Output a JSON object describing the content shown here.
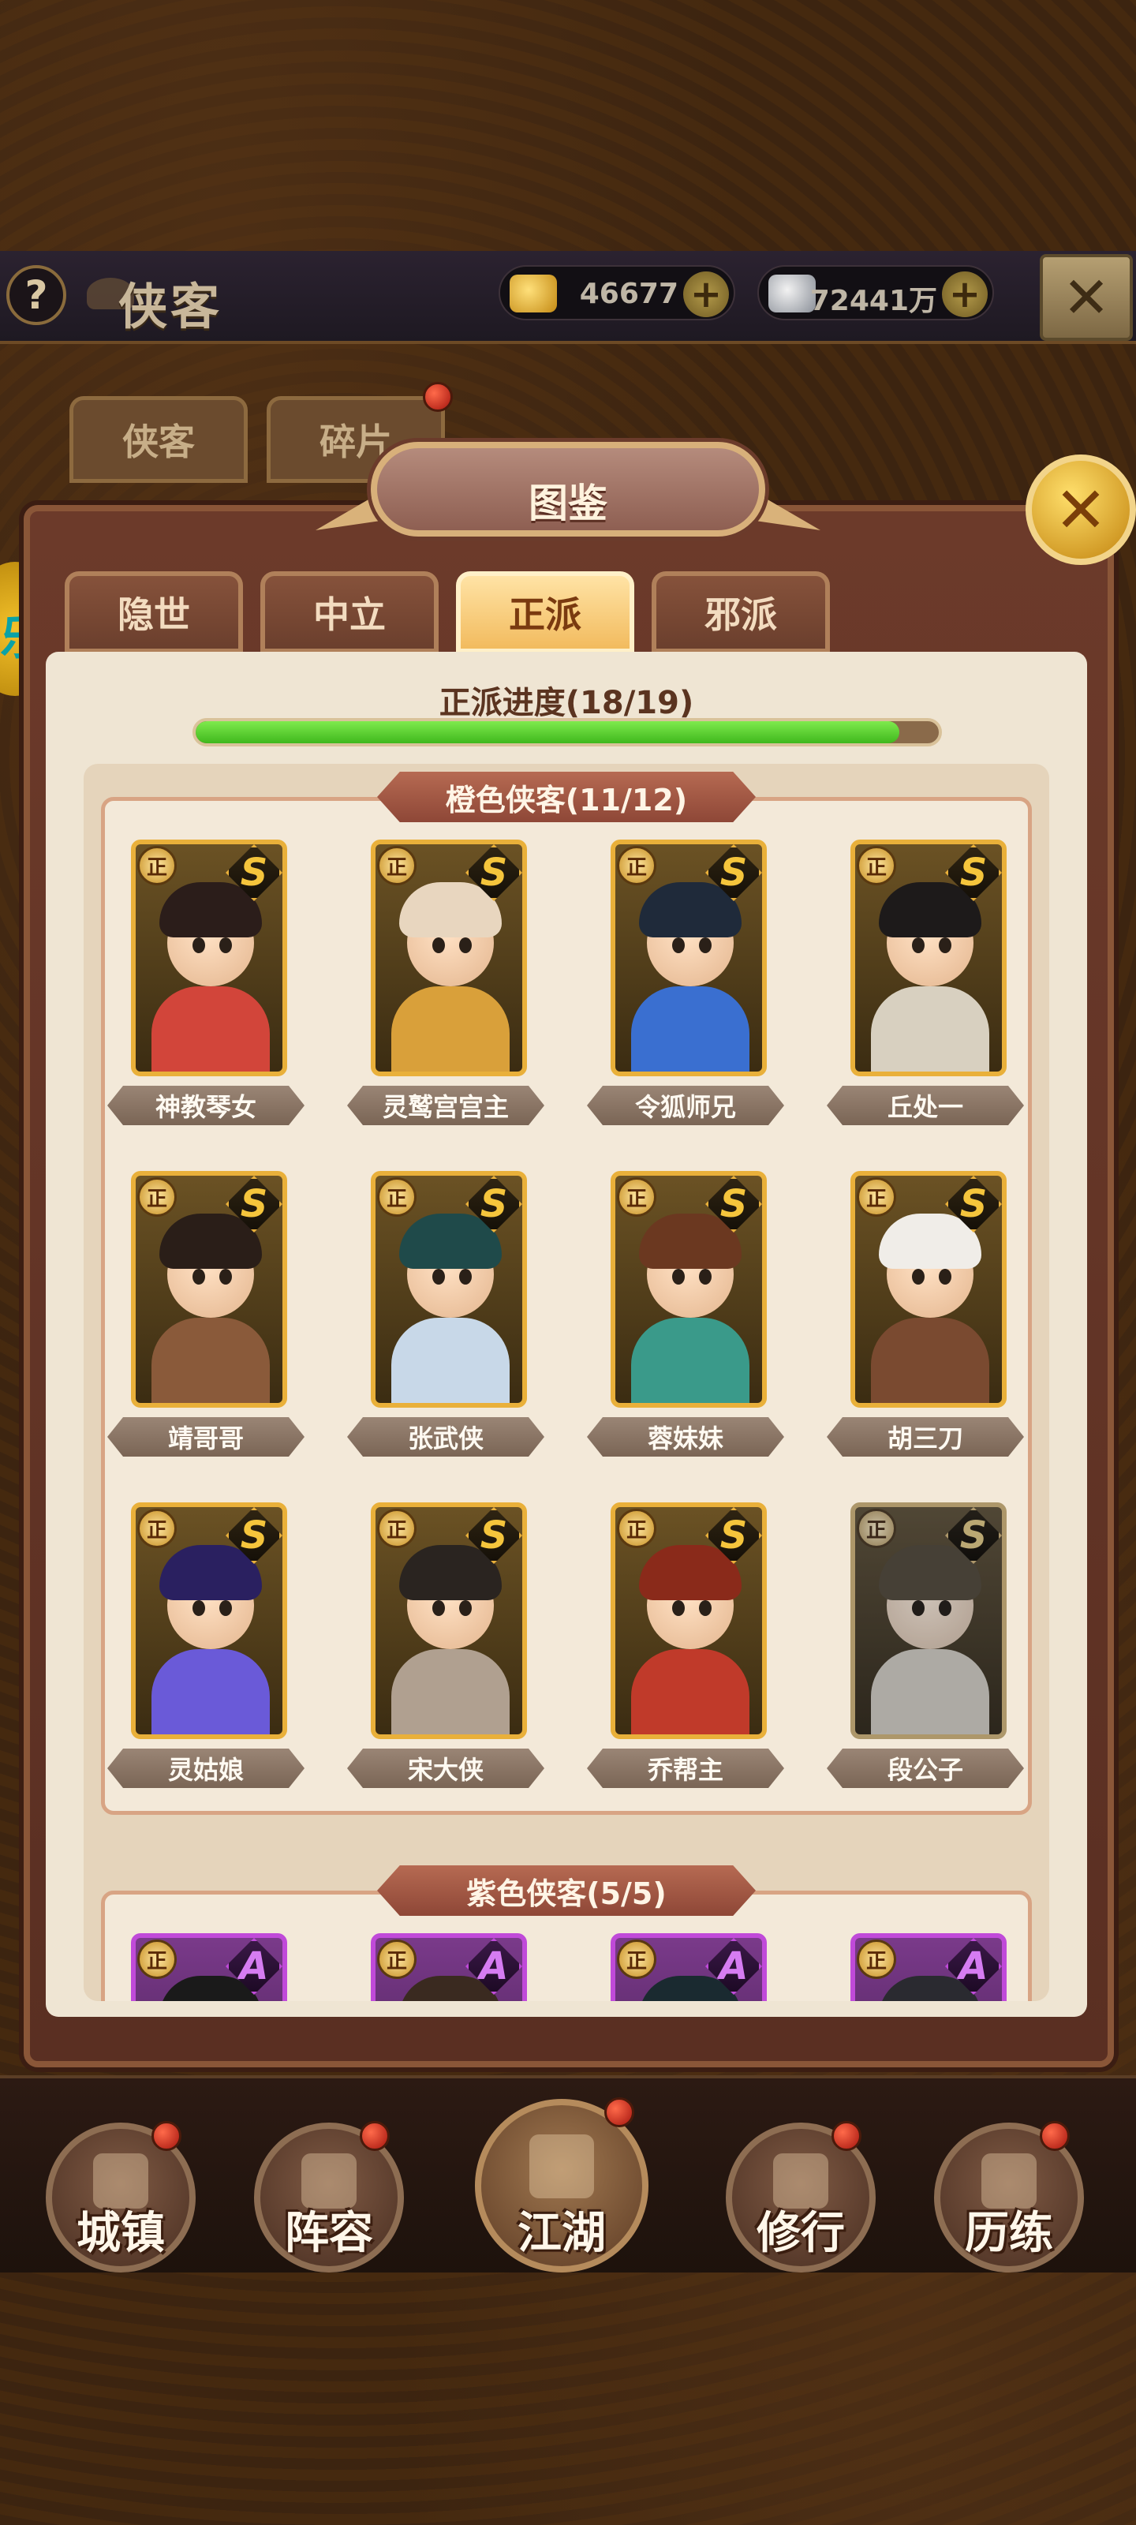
{
  "header": {
    "title": "侠客",
    "help_icon": "?",
    "gold": "46677",
    "silver": "72441万",
    "plus": "+",
    "close_glyph": "✕"
  },
  "bg_tabs": [
    "侠客",
    "碎片"
  ],
  "side_badge": "乐",
  "dialog": {
    "title": "图鉴",
    "close_glyph": "✕"
  },
  "faction_tabs": [
    {
      "label": "隐世",
      "active": false
    },
    {
      "label": "中立",
      "active": false
    },
    {
      "label": "正派",
      "active": true
    },
    {
      "label": "邪派",
      "active": false
    }
  ],
  "progress": {
    "label": "正派进度(18/19)",
    "current": 18,
    "total": 19
  },
  "sections": [
    {
      "header": "橙色侠客(11/12)",
      "grade": "S",
      "color": "#e9b03a",
      "heroes": [
        {
          "name": "神教琴女",
          "tag": "正",
          "hair": "#2b1d1a",
          "outfit": "#d2453a"
        },
        {
          "name": "灵鹫宫宫主",
          "tag": "正",
          "hair": "#e8d6bf",
          "outfit": "#d9a03a"
        },
        {
          "name": "令狐师兄",
          "tag": "正",
          "hair": "#1f2a3a",
          "outfit": "#3a6fd0"
        },
        {
          "name": "丘处一",
          "tag": "正",
          "hair": "#1d1a1a",
          "outfit": "#d8d0c0"
        },
        {
          "name": "靖哥哥",
          "tag": "正",
          "hair": "#2a1e18",
          "outfit": "#8a5a3a"
        },
        {
          "name": "张武侠",
          "tag": "正",
          "hair": "#1f4a4a",
          "outfit": "#c8d8e8"
        },
        {
          "name": "蓉妹妹",
          "tag": "正",
          "hair": "#6b3820",
          "outfit": "#3a9a8a"
        },
        {
          "name": "胡三刀",
          "tag": "正",
          "hair": "#f0ede8",
          "outfit": "#7a4a30"
        },
        {
          "name": "灵姑娘",
          "tag": "正",
          "hair": "#2a2060",
          "outfit": "#6a5ad8"
        },
        {
          "name": "宋大侠",
          "tag": "正",
          "hair": "#2a2420",
          "outfit": "#b0a090"
        },
        {
          "name": "乔帮主",
          "tag": "正",
          "hair": "#8a2a1a",
          "outfit": "#c03a2a"
        },
        {
          "name": "段公子",
          "tag": "正",
          "hair": "#5a4a30",
          "outfit": "#cfc8b8",
          "locked": true
        }
      ]
    },
    {
      "header": "紫色侠客(5/5)",
      "grade": "A",
      "color": "#c04ad9",
      "heroes": [
        {
          "name": "",
          "tag": "正",
          "hair": "#1a1a1a",
          "outfit": "#5a3a2a"
        },
        {
          "name": "",
          "tag": "正",
          "hair": "#3a2a20",
          "outfit": "#8a5a9a"
        },
        {
          "name": "",
          "tag": "正",
          "hair": "#1a2a30",
          "outfit": "#3a5a6a"
        },
        {
          "name": "",
          "tag": "正",
          "hair": "#2a2a30",
          "outfit": "#4a4a5a"
        }
      ]
    }
  ],
  "bottom_nav": [
    {
      "label": "城镇",
      "icon": "town-icon"
    },
    {
      "label": "阵容",
      "icon": "lineup-icon"
    },
    {
      "label": "江湖",
      "icon": "jianghu-scroll-icon"
    },
    {
      "label": "修行",
      "icon": "cultivate-icon"
    },
    {
      "label": "历练",
      "icon": "training-icon"
    }
  ]
}
